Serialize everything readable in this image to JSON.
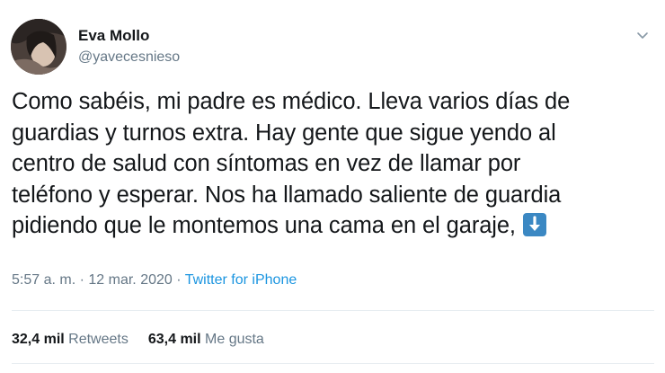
{
  "author": {
    "name": "Eva Mollo",
    "handle": "@yavecesnieso"
  },
  "tweet": {
    "lines": [
      "Como sabéis, mi padre es médico. Lleva varios días de",
      "guardias y turnos extra. Hay gente que sigue yendo al",
      "centro de salud con síntomas en vez de llamar por",
      "teléfono y esperar. Nos ha llamado saliente de guardia",
      "pidiendo que le montemos una cama en el garaje,"
    ],
    "trailing_emoji": "down-arrow-emoji"
  },
  "meta": {
    "time": "5:57 a. m.",
    "separator": "·",
    "date": "12 mar. 2020",
    "source": "Twitter for iPhone"
  },
  "stats": {
    "retweets_count": "32,4 mil",
    "retweets_label": "Retweets",
    "likes_count": "63,4 mil",
    "likes_label": "Me gusta"
  },
  "colors": {
    "text": "#14171a",
    "secondary": "#657786",
    "link": "#1b95e0",
    "emoji_bg": "#3b88c3",
    "divider": "#e6ecf0"
  }
}
